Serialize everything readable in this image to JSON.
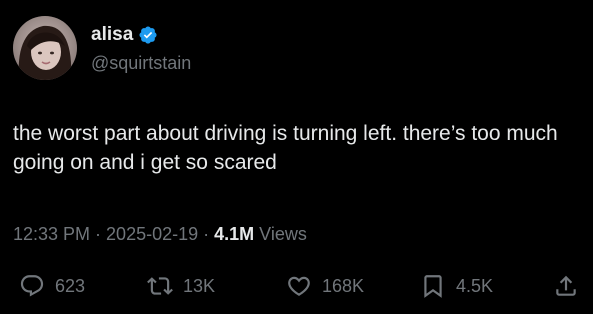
{
  "author": {
    "display_name": "alisa",
    "handle": "@squirtstain",
    "verified": true,
    "verified_color": "#1d9bf0",
    "avatar": "avatar-photo"
  },
  "tweet": {
    "text": "the worst part about driving is turning left. there’s too much going on and i get so scared"
  },
  "meta": {
    "time": "12:33 PM",
    "separator": "·",
    "date": "2025-02-19",
    "views_count": "4.1M",
    "views_label": "Views"
  },
  "actions": {
    "replies": "623",
    "reposts": "13K",
    "likes": "168K",
    "bookmarks": "4.5K"
  },
  "icons": {
    "reply": "reply-icon",
    "repost": "repost-icon",
    "like": "heart-icon",
    "bookmark": "bookmark-icon",
    "share": "share-icon"
  },
  "colors": {
    "background": "#000000",
    "text_primary": "#e7e9ea",
    "text_secondary": "#71767b"
  }
}
